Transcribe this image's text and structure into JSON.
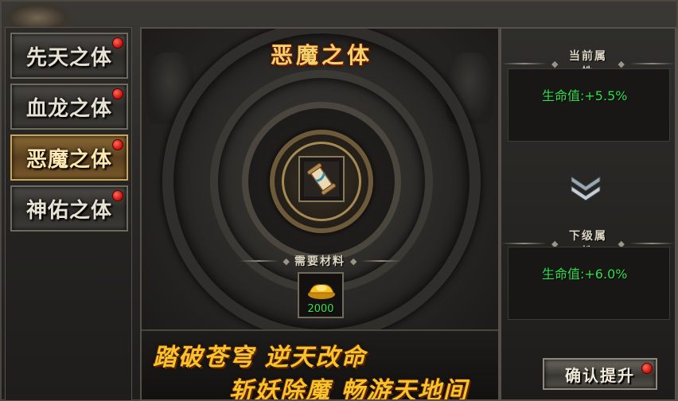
{
  "sidebar": {
    "tabs": [
      {
        "label": "先天之体",
        "active": false,
        "has_alert": true
      },
      {
        "label": "血龙之体",
        "active": false,
        "has_alert": true
      },
      {
        "label": "恶魔之体",
        "active": true,
        "has_alert": true
      },
      {
        "label": "神佑之体",
        "active": false,
        "has_alert": true
      }
    ]
  },
  "center": {
    "title": "恶魔之体",
    "item_icon": "scroll-icon",
    "materials_header": "需要材料",
    "material": {
      "icon": "gold-ingot-icon",
      "count": "2000"
    },
    "slogans": {
      "line1": "踏破苍穹 逆天改命",
      "line2": "斩妖除魔 畅游天地间"
    }
  },
  "right": {
    "current_header": "当前属性",
    "current_attr": "生命值:+5.5%",
    "next_header": "下级属性",
    "next_attr": "生命值:+6.0%",
    "confirm_label": "确认提升",
    "confirm_has_alert": true
  },
  "colors": {
    "attr_green": "#2fe04a",
    "title_gold": "#f3d26a",
    "slogan_gold": "#f7c22a",
    "alert_red": "#c4100a"
  }
}
